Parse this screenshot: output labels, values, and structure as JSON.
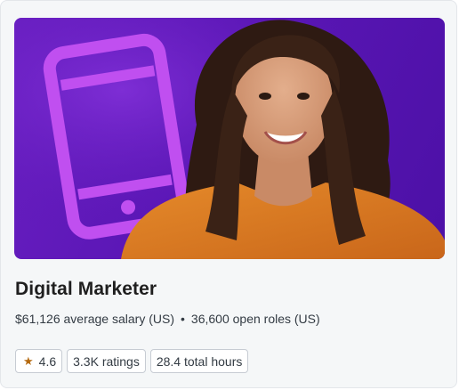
{
  "card": {
    "title": "Digital Marketer",
    "salary": "$61,126 average salary (US)",
    "separator": "•",
    "open_roles": "36,600 open roles (US)",
    "stats": {
      "rating": "4.6",
      "ratings_count": "3.3K ratings",
      "total_hours": "28.4 total hours"
    }
  },
  "icons": {
    "hero_illustration": "smartphone-icon",
    "rating_icon": "star-icon"
  },
  "colors": {
    "hero_background": "#5a16b5",
    "phone_outline": "#c04ff0",
    "star": "#b4690e",
    "title": "#1f1f1f"
  }
}
